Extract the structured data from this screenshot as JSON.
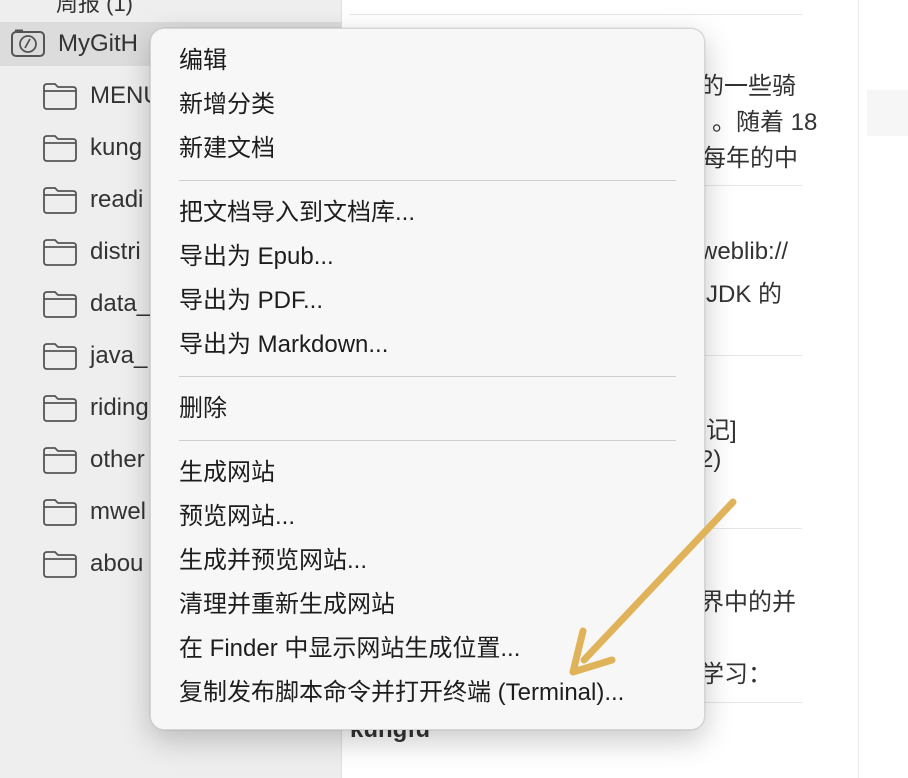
{
  "sidebar": {
    "top_cut_label": "周报 (1)",
    "library": {
      "label": "MyGitH",
      "icon": "library-compass-icon"
    },
    "folders": [
      {
        "label": "MENU"
      },
      {
        "label": "kung"
      },
      {
        "label": "readi"
      },
      {
        "label": "distri"
      },
      {
        "label": "data_"
      },
      {
        "label": "java_"
      },
      {
        "label": "riding"
      },
      {
        "label": "other"
      },
      {
        "label": "mwel"
      },
      {
        "label": "abou"
      }
    ]
  },
  "doclist": {
    "snippets": [
      "的一些骑",
      "。随着 18",
      "每年的中",
      "weblib://",
      "JDK 的",
      "记]",
      "2)",
      "界中的并",
      "学习：",
      "kungfu"
    ]
  },
  "context_menu": {
    "groups": [
      [
        "编辑",
        "新增分类",
        "新建文档"
      ],
      [
        "把文档导入到文档库...",
        "导出为 Epub...",
        "导出为 PDF...",
        "导出为 Markdown..."
      ],
      [
        "删除"
      ],
      [
        "生成网站",
        "预览网站...",
        "生成并预览网站...",
        "清理并重新生成网站",
        "在 Finder 中显示网站生成位置...",
        "复制发布脚本命令并打开终端 (Terminal)..."
      ]
    ]
  },
  "annotation": {
    "color": "#e0b35a",
    "icon": "arrow-icon"
  }
}
